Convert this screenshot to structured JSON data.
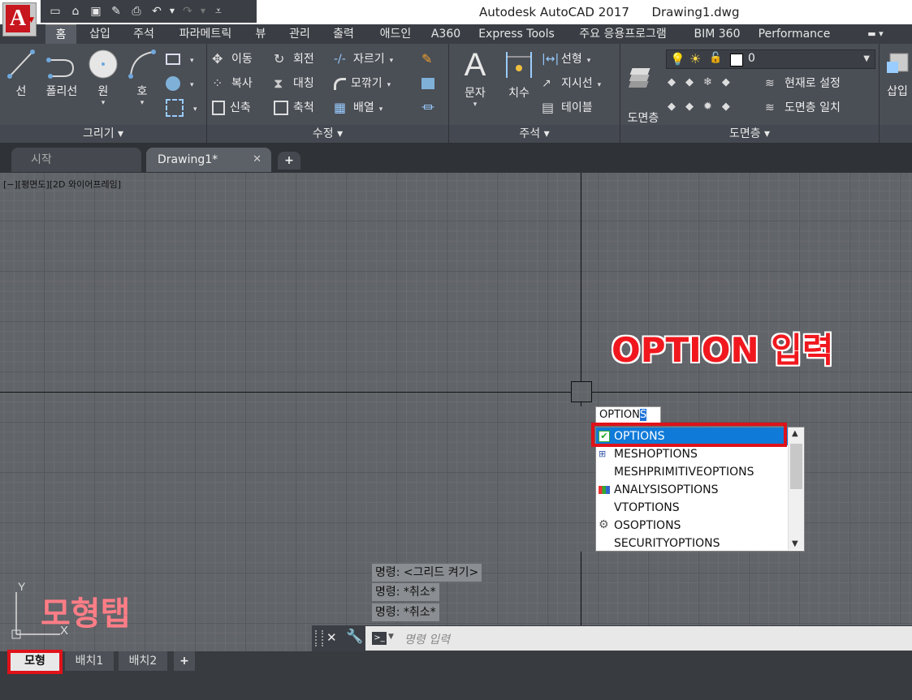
{
  "title_bar": {
    "app_name": "Autodesk AutoCAD 2017",
    "file_name": "Drawing1.dwg"
  },
  "ribbon_tabs": [
    "홈",
    "삽입",
    "주석",
    "파라메트릭",
    "뷰",
    "관리",
    "출력",
    "애드인",
    "A360",
    "Express Tools",
    "주요 응용프로그램",
    "BIM 360",
    "Performance"
  ],
  "panels": {
    "draw": {
      "label": "그리기 ▾",
      "buttons": [
        "선",
        "폴리선",
        "원",
        "호"
      ]
    },
    "modify": {
      "label": "수정 ▾",
      "buttons": [
        "이동",
        "회전",
        "자르기",
        "복사",
        "대칭",
        "모깎기",
        "신축",
        "축척",
        "배열"
      ]
    },
    "annotation": {
      "label": "주석 ▾",
      "buttons": [
        "문자",
        "치수",
        "선형",
        "지시선",
        "테이블"
      ]
    },
    "layers": {
      "label": "도면층 ▾",
      "layer_props": "도면층\n특성",
      "current_layer": "0",
      "buttons": [
        "현재로 설정",
        "도면층 일치"
      ]
    },
    "insert": {
      "label": "삽입"
    }
  },
  "doc_tabs": [
    "시작",
    "Drawing1*"
  ],
  "viewport_label": "[−][평면도][2D 와이어프레임]",
  "annotations": {
    "option_input": "OPTION 입력",
    "model_tab": "모형탭"
  },
  "command_input": {
    "typed": "OPTION",
    "highlighted": "S"
  },
  "autocomplete": {
    "items": [
      "OPTIONS",
      "MESHOPTIONS",
      "MESHPRIMITIVEOPTIONS",
      "ANALYSISOPTIONS",
      "VTOPTIONS",
      "OSOPTIONS",
      "SECURITYOPTIONS"
    ],
    "selected": "OPTIONS"
  },
  "command_history": [
    "명령: <그리드 켜기>",
    "명령: *취소*",
    "명령: *취소*"
  ],
  "command_placeholder": "명령 입력",
  "layout_tabs": [
    "모형",
    "배치1",
    "배치2"
  ],
  "colors": {
    "accent_red": "#e0121a",
    "selection_blue": "#0f7ad8",
    "canvas": "#616469"
  }
}
